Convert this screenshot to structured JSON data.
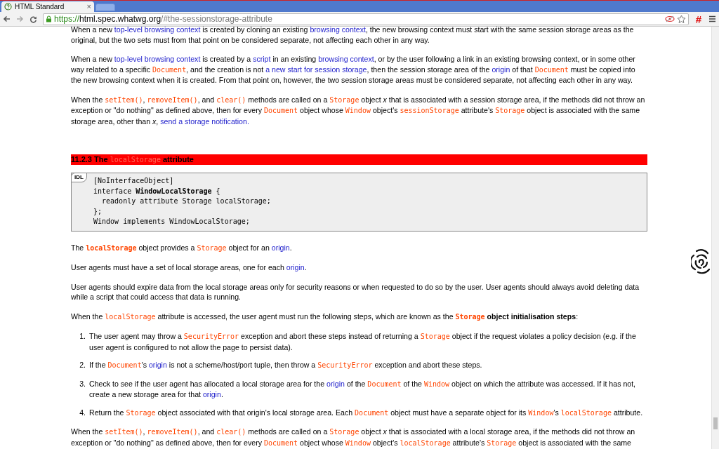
{
  "browser": {
    "tab": {
      "title": "HTML Standard",
      "close": "×"
    },
    "url": {
      "scheme": "https://",
      "host": "html.spec.whatwg.org",
      "path": "/#the-sessionstorage-attribute"
    },
    "extension_label": "#"
  },
  "content": [
    {
      "kind": "p",
      "runs": [
        {
          "kind": "text",
          "text": "When a new "
        },
        {
          "kind": "link",
          "text": "top-level browsing context"
        },
        {
          "kind": "text",
          "text": " is created by cloning an existing "
        },
        {
          "kind": "link",
          "text": "browsing context"
        },
        {
          "kind": "text",
          "text": ", the new browsing context must start with the same session storage areas as the original, but the two sets must from that point on be considered separate, not affecting each other in any way."
        }
      ]
    },
    {
      "kind": "p",
      "runs": [
        {
          "kind": "text",
          "text": "When a new "
        },
        {
          "kind": "link",
          "text": "top-level browsing context"
        },
        {
          "kind": "text",
          "text": " is created by a "
        },
        {
          "kind": "link",
          "text": "script"
        },
        {
          "kind": "text",
          "text": " in an existing "
        },
        {
          "kind": "link",
          "text": "browsing context"
        },
        {
          "kind": "text",
          "text": ", or by the user following a link in an existing browsing context, or in some other way related to a specific "
        },
        {
          "kind": "code",
          "text": "Document"
        },
        {
          "kind": "text",
          "text": ", and the creation is not "
        },
        {
          "kind": "link",
          "text": "a new start for session storage"
        },
        {
          "kind": "text",
          "text": ", then the session storage area of the "
        },
        {
          "kind": "link",
          "text": "origin"
        },
        {
          "kind": "text",
          "text": " of that "
        },
        {
          "kind": "code",
          "text": "Document"
        },
        {
          "kind": "text",
          "text": " must be copied into the new browsing context when it is created. From that point on, however, the two session storage areas must be considered separate, not affecting each other in any way."
        }
      ]
    },
    {
      "kind": "p",
      "runs": [
        {
          "kind": "text",
          "text": "When the "
        },
        {
          "kind": "code",
          "text": "setItem()"
        },
        {
          "kind": "text",
          "text": ", "
        },
        {
          "kind": "code",
          "text": "removeItem()"
        },
        {
          "kind": "text",
          "text": ", and "
        },
        {
          "kind": "code",
          "text": "clear()"
        },
        {
          "kind": "text",
          "text": " methods are called on a "
        },
        {
          "kind": "code",
          "text": "Storage"
        },
        {
          "kind": "text",
          "text": " object "
        },
        {
          "kind": "var",
          "text": "x"
        },
        {
          "kind": "text",
          "text": " that is associated with a session storage area, if the methods did not throw an exception or \"do nothing\" as defined above, then for every "
        },
        {
          "kind": "code",
          "text": "Document"
        },
        {
          "kind": "text",
          "text": " object whose "
        },
        {
          "kind": "code",
          "text": "Window"
        },
        {
          "kind": "text",
          "text": " object's "
        },
        {
          "kind": "code",
          "text": "sessionStorage"
        },
        {
          "kind": "text",
          "text": " attribute's "
        },
        {
          "kind": "code",
          "text": "Storage"
        },
        {
          "kind": "text",
          "text": " object is associated with the same storage area, other than "
        },
        {
          "kind": "var",
          "text": "x"
        },
        {
          "kind": "text",
          "text": ", "
        },
        {
          "kind": "link",
          "text": "send a storage notification."
        }
      ]
    },
    {
      "kind": "heading",
      "runs": [
        {
          "kind": "text",
          "text": "11.2.3 The "
        },
        {
          "kind": "code",
          "text": "localStorage"
        },
        {
          "kind": "text",
          "text": " attribute"
        }
      ]
    },
    {
      "kind": "idl",
      "badge": "IDL",
      "lines": [
        "[NoInterfaceObject]",
        "interface **WindowLocalStorage** {",
        "  readonly attribute Storage localStorage;",
        "};",
        "Window implements WindowLocalStorage;"
      ]
    },
    {
      "kind": "p",
      "runs": [
        {
          "kind": "text",
          "text": "The "
        },
        {
          "kind": "code_strong",
          "text": "localStorage"
        },
        {
          "kind": "text",
          "text": " object provides a "
        },
        {
          "kind": "code",
          "text": "Storage"
        },
        {
          "kind": "text",
          "text": " object for an "
        },
        {
          "kind": "link",
          "text": "origin"
        },
        {
          "kind": "text",
          "text": "."
        }
      ]
    },
    {
      "kind": "p",
      "runs": [
        {
          "kind": "text",
          "text": "User agents must have a set of local storage areas, one for each "
        },
        {
          "kind": "link",
          "text": "origin"
        },
        {
          "kind": "text",
          "text": "."
        }
      ]
    },
    {
      "kind": "p",
      "runs": [
        {
          "kind": "text",
          "text": "User agents should expire data from the local storage areas only for security reasons or when requested to do so by the user. User agents should always avoid deleting data while a script that could access that data is running."
        }
      ]
    },
    {
      "kind": "p",
      "runs": [
        {
          "kind": "text",
          "text": "When the "
        },
        {
          "kind": "code",
          "text": "localStorage"
        },
        {
          "kind": "text",
          "text": " attribute is accessed, the user agent must run the following steps, which are known as the "
        },
        {
          "kind": "code_strong",
          "text": "Storage"
        },
        {
          "kind": "strong",
          "text": " object initialisation steps"
        },
        {
          "kind": "text",
          "text": ":"
        }
      ]
    },
    {
      "kind": "ol",
      "items": [
        {
          "number": "1.",
          "runs": [
            {
              "kind": "text",
              "text": "The user agent may throw a "
            },
            {
              "kind": "code",
              "text": "SecurityError"
            },
            {
              "kind": "text",
              "text": " exception and abort these steps instead of returning a "
            },
            {
              "kind": "code",
              "text": "Storage"
            },
            {
              "kind": "text",
              "text": " object if the request violates a policy decision (e.g. if the user agent is configured to not allow the page to persist data)."
            }
          ]
        },
        {
          "number": "2.",
          "runs": [
            {
              "kind": "text",
              "text": "If the "
            },
            {
              "kind": "code",
              "text": "Document"
            },
            {
              "kind": "text",
              "text": "'s "
            },
            {
              "kind": "link",
              "text": "origin"
            },
            {
              "kind": "text",
              "text": " is not a scheme/host/port tuple, then throw a "
            },
            {
              "kind": "code",
              "text": "SecurityError"
            },
            {
              "kind": "text",
              "text": " exception and abort these steps."
            }
          ]
        },
        {
          "number": "3.",
          "runs": [
            {
              "kind": "text",
              "text": "Check to see if the user agent has allocated a local storage area for the "
            },
            {
              "kind": "link",
              "text": "origin"
            },
            {
              "kind": "text",
              "text": " of the "
            },
            {
              "kind": "code",
              "text": "Document"
            },
            {
              "kind": "text",
              "text": " of the "
            },
            {
              "kind": "code",
              "text": "Window"
            },
            {
              "kind": "text",
              "text": " object on which the attribute was accessed. If it has not, create a new storage area for that "
            },
            {
              "kind": "link",
              "text": "origin"
            },
            {
              "kind": "text",
              "text": "."
            }
          ]
        },
        {
          "number": "4.",
          "runs": [
            {
              "kind": "text",
              "text": "Return the "
            },
            {
              "kind": "code",
              "text": "Storage"
            },
            {
              "kind": "text",
              "text": " object associated with that origin's local storage area. Each "
            },
            {
              "kind": "code",
              "text": "Document"
            },
            {
              "kind": "text",
              "text": " object must have a separate object for its "
            },
            {
              "kind": "code",
              "text": "Window"
            },
            {
              "kind": "text",
              "text": "'s "
            },
            {
              "kind": "code",
              "text": "localStorage"
            },
            {
              "kind": "text",
              "text": " attribute."
            }
          ]
        }
      ]
    },
    {
      "kind": "p",
      "runs": [
        {
          "kind": "text",
          "text": "When the "
        },
        {
          "kind": "code",
          "text": "setItem()"
        },
        {
          "kind": "text",
          "text": ", "
        },
        {
          "kind": "code",
          "text": "removeItem()"
        },
        {
          "kind": "text",
          "text": ", and "
        },
        {
          "kind": "code",
          "text": "clear()"
        },
        {
          "kind": "text",
          "text": " methods are called on a "
        },
        {
          "kind": "code",
          "text": "Storage"
        },
        {
          "kind": "text",
          "text": " object "
        },
        {
          "kind": "var",
          "text": "x"
        },
        {
          "kind": "text",
          "text": " that is associated with a local storage area, if the methods did not throw an exception or \"do nothing\" as defined above, then for every "
        },
        {
          "kind": "code",
          "text": "Document"
        },
        {
          "kind": "text",
          "text": " object whose "
        },
        {
          "kind": "code",
          "text": "Window"
        },
        {
          "kind": "text",
          "text": " object's "
        },
        {
          "kind": "code",
          "text": "localStorage"
        },
        {
          "kind": "text",
          "text": " attribute's "
        },
        {
          "kind": "code",
          "text": "Storage"
        },
        {
          "kind": "text",
          "text": " object is associated with the same"
        }
      ]
    }
  ]
}
